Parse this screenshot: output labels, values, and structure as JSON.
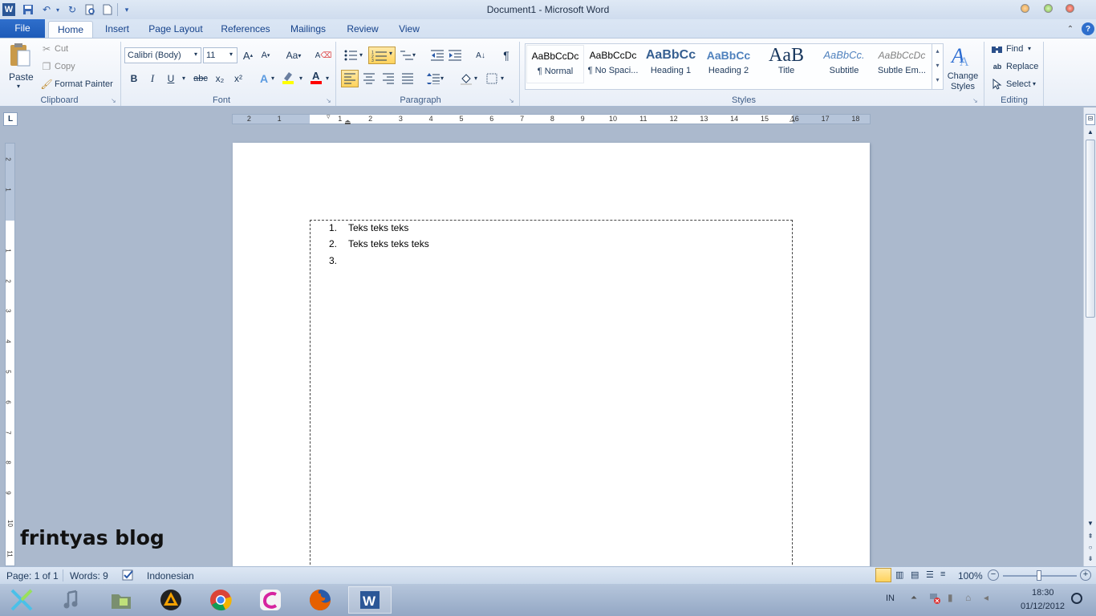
{
  "window": {
    "title": "Document1  -  Microsoft Word"
  },
  "tabs": [
    "File",
    "Home",
    "Insert",
    "Page Layout",
    "References",
    "Mailings",
    "Review",
    "View"
  ],
  "clipboard": {
    "paste": "Paste",
    "cut": "Cut",
    "copy": "Copy",
    "format_painter": "Format Painter",
    "label": "Clipboard"
  },
  "font": {
    "name": "Calibri (Body)",
    "size": "11",
    "label": "Font",
    "bold": "B",
    "italic": "I",
    "underline": "U",
    "strike": "abc",
    "sub": "x₂",
    "sup": "x²",
    "case": "Aa"
  },
  "paragraph": {
    "label": "Paragraph",
    "pilcrow": "¶"
  },
  "styles": {
    "label": "Styles",
    "items": [
      {
        "preview": "AaBbCcDc",
        "name": "¶ Normal"
      },
      {
        "preview": "AaBbCcDc",
        "name": "¶ No Spaci..."
      },
      {
        "preview": "AaBbCc",
        "name": "Heading 1"
      },
      {
        "preview": "AaBbCc",
        "name": "Heading 2"
      },
      {
        "preview": "AaB",
        "name": "Title"
      },
      {
        "preview": "AaBbCc.",
        "name": "Subtitle"
      },
      {
        "preview": "AaBbCcDc",
        "name": "Subtle Em..."
      }
    ],
    "change_line1": "Change",
    "change_line2": "Styles"
  },
  "editing": {
    "find": "Find",
    "replace": "Replace",
    "select": "Select",
    "label": "Editing"
  },
  "ruler_numbers": [
    "2",
    "1",
    "1",
    "2",
    "3",
    "4",
    "5",
    "6",
    "7",
    "8",
    "9",
    "10",
    "11",
    "12",
    "13",
    "14",
    "15",
    "16",
    "17",
    "18"
  ],
  "vruler_numbers": [
    "2",
    "1",
    "1",
    "2",
    "3",
    "4",
    "5",
    "6",
    "7",
    "8",
    "9",
    "10",
    "11"
  ],
  "document": {
    "list": [
      {
        "num": "1.",
        "text": "Teks teks teks"
      },
      {
        "num": "2.",
        "text": "Teks teks teks teks"
      },
      {
        "num": "3.",
        "text": ""
      }
    ]
  },
  "watermark": "frintyas blog",
  "status": {
    "page": "Page: 1 of 1",
    "words": "Words: 9",
    "language": "Indonesian",
    "zoom": "100%"
  },
  "tray": {
    "lang": "IN",
    "time": "18:30",
    "date": "01/12/2012"
  },
  "colors": {
    "file_tab": "#1e5bb8",
    "workspace": "#abb9cd",
    "highlight_yellow": "#ffff00",
    "font_red": "#ff0000"
  }
}
